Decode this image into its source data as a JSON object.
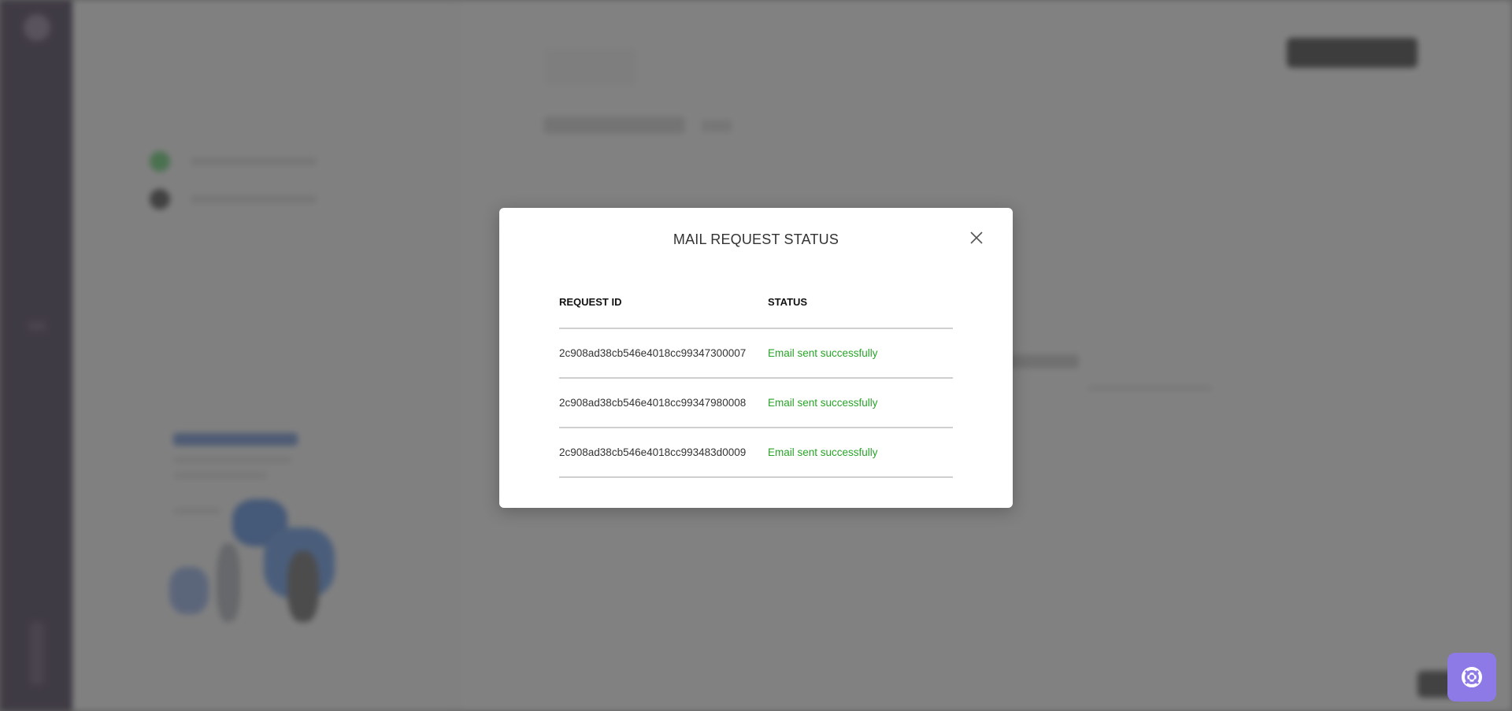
{
  "modal": {
    "title": "MAIL REQUEST STATUS",
    "close_icon": "close-icon",
    "columns": [
      "REQUEST ID",
      "STATUS"
    ],
    "rows": [
      {
        "request_id": "2c908ad38cb546e4018cc99347300007",
        "status": "Email sent successfully"
      },
      {
        "request_id": "2c908ad38cb546e4018cc99347980008",
        "status": "Email sent successfully"
      },
      {
        "request_id": "2c908ad38cb546e4018cc993483d0009",
        "status": "Email sent successfully"
      }
    ]
  },
  "help_button": {
    "icon": "lifebuoy-icon"
  },
  "colors": {
    "success": "#28a428",
    "help_accent": "#8d7ae6",
    "sidebar": "#1a0a2a"
  }
}
